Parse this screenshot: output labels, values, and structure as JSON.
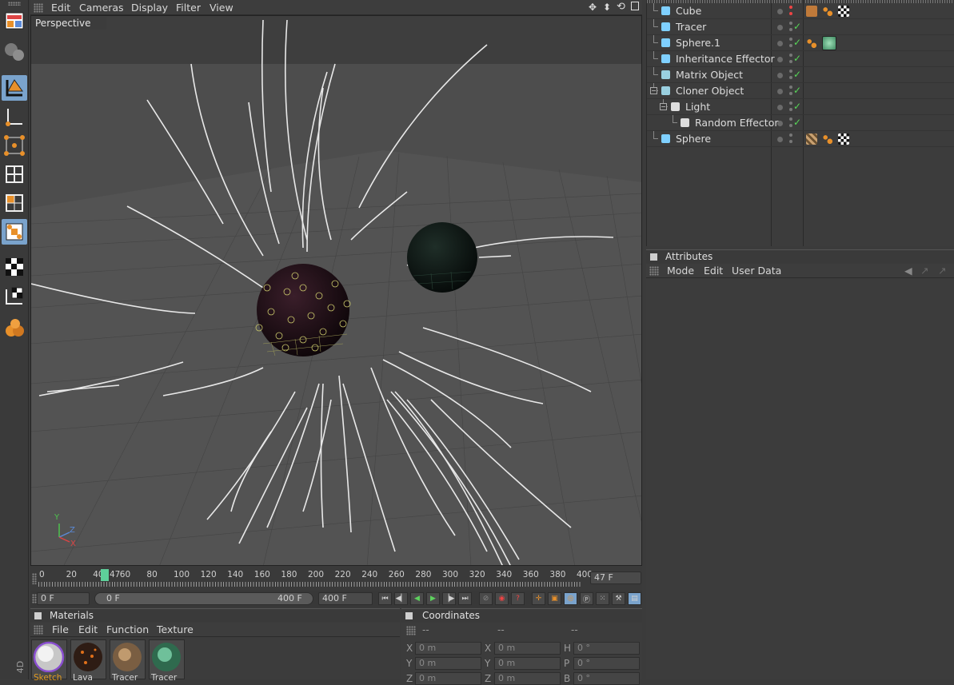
{
  "viewport": {
    "menu": [
      "Edit",
      "Cameras",
      "Display",
      "Filter",
      "View"
    ],
    "camera_label": "Perspective",
    "axis_labels": {
      "y": "Y",
      "z": "Z",
      "x": "X"
    }
  },
  "timeline": {
    "ticks": [
      "0",
      "20",
      "40",
      "60",
      "80",
      "100",
      "120",
      "140",
      "160",
      "180",
      "200",
      "220",
      "240",
      "260",
      "280",
      "300",
      "320",
      "340",
      "360",
      "380",
      "400"
    ],
    "playhead_label": "47",
    "current_frame": "47 F",
    "start_frame": "0 F",
    "range_start": "0 F",
    "range_end": "400 F",
    "end_frame": "400 F"
  },
  "materials": {
    "title": "Materials",
    "menu": [
      "File",
      "Edit",
      "Function",
      "Texture"
    ],
    "items": [
      {
        "label": "Sketch",
        "color": "#e09a20"
      },
      {
        "label": "Lava",
        "color": "#d6d6d6"
      },
      {
        "label": "Tracer",
        "color": "#d6d6d6"
      },
      {
        "label": "Tracer",
        "color": "#d6d6d6"
      }
    ]
  },
  "coordinates": {
    "title": "Coordinates",
    "headers": [
      "--",
      "--",
      "--"
    ],
    "rows": [
      {
        "a": "X",
        "av": "0 m",
        "b": "X",
        "bv": "0 m",
        "c": "H",
        "cv": "0 °"
      },
      {
        "a": "Y",
        "av": "0 m",
        "b": "Y",
        "bv": "0 m",
        "c": "P",
        "cv": "0 °"
      },
      {
        "a": "Z",
        "av": "0 m",
        "b": "Z",
        "bv": "0 m",
        "c": "B",
        "cv": "0 °"
      }
    ]
  },
  "objects": [
    {
      "name": "Cube",
      "indent": 0
    },
    {
      "name": "Tracer",
      "indent": 0
    },
    {
      "name": "Sphere.1",
      "indent": 0
    },
    {
      "name": "Inheritance Effector",
      "indent": 0
    },
    {
      "name": "Matrix Object",
      "indent": 0
    },
    {
      "name": "Cloner Object",
      "indent": 0
    },
    {
      "name": "Light",
      "indent": 1
    },
    {
      "name": "Random Effector",
      "indent": 2
    },
    {
      "name": "Sphere",
      "indent": 0
    }
  ],
  "attributes": {
    "title": "Attributes",
    "menu": [
      "Mode",
      "Edit",
      "User Data"
    ]
  },
  "colors": {
    "accent_blue": "#7aa3cc",
    "check_green": "#57d657",
    "playhead": "#5ed09a",
    "tool_orange": "#e8902a"
  }
}
